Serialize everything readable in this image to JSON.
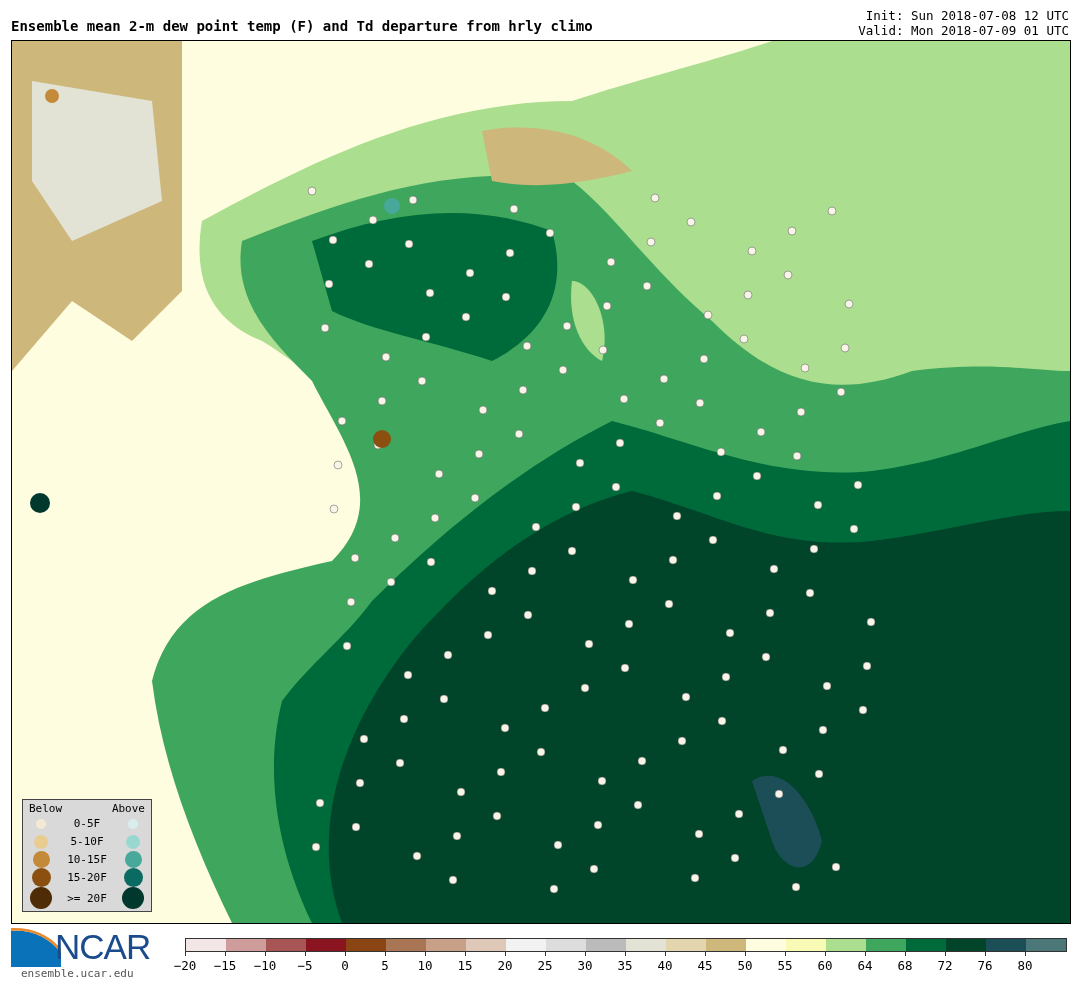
{
  "title": "Ensemble mean 2-m dew point temp (F) and Td departure from hrly climo",
  "init": "Init: Sun 2018-07-08 12 UTC",
  "valid": "Valid: Mon 2018-07-09 01 UTC",
  "legend": {
    "below_label": "Below",
    "above_label": "Above",
    "entries": [
      {
        "label": "0-5F",
        "below": {
          "color": "#f3ead6"
        },
        "above": {
          "color": "#d8eeee"
        }
      },
      {
        "label": "5-10F",
        "below": {
          "color": "#e8cc90"
        },
        "above": {
          "color": "#99d8d0"
        }
      },
      {
        "label": "10-15F",
        "below": {
          "color": "#c48a3a"
        },
        "above": {
          "color": "#48a89a"
        }
      },
      {
        "label": "15-20F",
        "below": {
          "color": "#8b5010"
        },
        "above": {
          "color": "#0a6b63"
        }
      },
      {
        "label": ">= 20F",
        "below": {
          "color": "#4e2c06"
        },
        "above": {
          "color": "#00382e"
        }
      }
    ]
  },
  "logo": {
    "text": "NCAR",
    "url": "ensemble.ucar.edu"
  },
  "colorbar": {
    "segments": [
      {
        "color": "#f3e6e6"
      },
      {
        "color": "#cf9c9c"
      },
      {
        "color": "#a85555"
      },
      {
        "color": "#8a1520"
      },
      {
        "color": "#8b4513"
      },
      {
        "color": "#a87555"
      },
      {
        "color": "#c8a088"
      },
      {
        "color": "#e0c8b8"
      },
      {
        "color": "#f2f2f2"
      },
      {
        "color": "#dddddd"
      },
      {
        "color": "#bbbbbb"
      },
      {
        "color": "#e2e2d5"
      },
      {
        "color": "#e3d5ad"
      },
      {
        "color": "#cdb77b"
      },
      {
        "color": "#fffde0"
      },
      {
        "color": "#f8fab5"
      },
      {
        "color": "#abde8f"
      },
      {
        "color": "#3fa75d"
      },
      {
        "color": "#006b3a"
      },
      {
        "color": "#00442a"
      },
      {
        "color": "#1b4e56"
      },
      {
        "color": "#4b7778"
      }
    ],
    "ticks": [
      "−20",
      "−15",
      "−10",
      "−5",
      "0",
      "5",
      "10",
      "15",
      "20",
      "25",
      "30",
      "35",
      "40",
      "45",
      "50",
      "55",
      "60",
      "64",
      "68",
      "72",
      "76",
      "80"
    ]
  }
}
